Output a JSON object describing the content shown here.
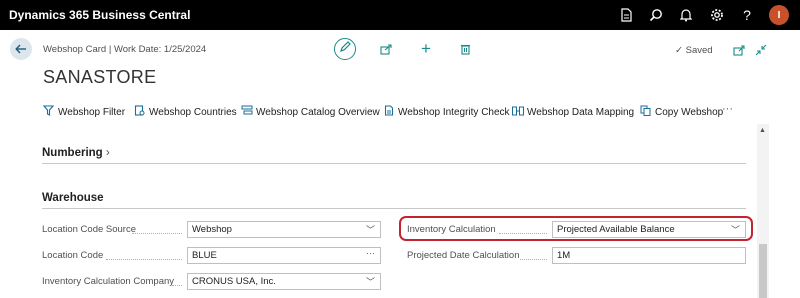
{
  "app": {
    "title": "Dynamics 365 Business Central",
    "avatar_initial": "I",
    "top_icons": [
      "document-icon",
      "search-icon",
      "bell-icon",
      "gear-icon",
      "help-icon"
    ]
  },
  "header": {
    "breadcrumb": "Webshop Card | Work Date: 1/25/2024",
    "title": "SANASTORE",
    "saved_label": "Saved"
  },
  "actions": [
    {
      "label": "Webshop Filter",
      "icon": "filter-icon"
    },
    {
      "label": "Webshop Countries",
      "icon": "countries-icon"
    },
    {
      "label": "Webshop Catalog Overview",
      "icon": "catalog-icon"
    },
    {
      "label": "Webshop Integrity Check",
      "icon": "integrity-icon"
    },
    {
      "label": "Webshop Data Mapping",
      "icon": "mapping-icon"
    },
    {
      "label": "Copy Webshop",
      "icon": "copy-icon"
    }
  ],
  "sections": {
    "numbering": {
      "heading": "Numbering"
    },
    "warehouse": {
      "heading": "Warehouse"
    }
  },
  "fields": {
    "location_code_source": {
      "label": "Location Code Source",
      "value": "Webshop"
    },
    "location_code": {
      "label": "Location Code",
      "value": "BLUE"
    },
    "inventory_calculation_company": {
      "label": "Inventory Calculation Company",
      "value": "CRONUS USA, Inc."
    },
    "inventory_calculation": {
      "label": "Inventory Calculation",
      "value": "Projected Available Balance"
    },
    "projected_date_calculation": {
      "label": "Projected Date Calculation",
      "value": "1M"
    }
  },
  "colors": {
    "topbar": "#000000",
    "accent": "#1a8a8a",
    "highlight": "#c52230",
    "avatar": "#c7512a"
  }
}
